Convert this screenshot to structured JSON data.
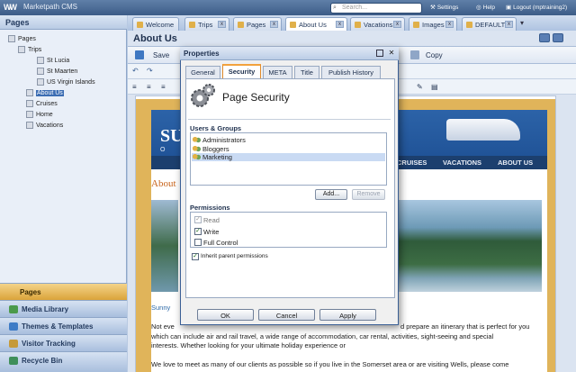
{
  "app": {
    "name": "Marketpath CMS",
    "logo": "WW"
  },
  "topbar": {
    "search_placeholder": "Search...",
    "settings": "Settings",
    "help": "Help",
    "logout": "Logout (mptraining2)"
  },
  "left_panel": {
    "title": "Pages",
    "tree": [
      {
        "label": "Pages",
        "indent": 0
      },
      {
        "label": "Trips",
        "indent": 1
      },
      {
        "label": "St Lucia",
        "indent": 2
      },
      {
        "label": "St Maarten",
        "indent": 2
      },
      {
        "label": "US Virgin Islands",
        "indent": 2
      },
      {
        "label": "About Us",
        "indent": 1,
        "selected": true
      },
      {
        "label": "Cruises",
        "indent": 1
      },
      {
        "label": "Home",
        "indent": 1
      },
      {
        "label": "Vacations",
        "indent": 1
      }
    ],
    "accordion": [
      "Pages",
      "Media Library",
      "Themes & Templates",
      "Visitor Tracking",
      "Recycle Bin"
    ]
  },
  "tabs": [
    {
      "label": "Welcome"
    },
    {
      "label": "Trips"
    },
    {
      "label": "Pages"
    },
    {
      "label": "About Us",
      "active": true
    },
    {
      "label": "Vacations"
    },
    {
      "label": "Images"
    },
    {
      "label": "DEFAULT"
    }
  ],
  "main": {
    "title": "About Us",
    "save_label": "Save",
    "copy_label": "Copy"
  },
  "site": {
    "nav": [
      "CRUISES",
      "VACATIONS",
      "ABOUT US"
    ],
    "heading_fragment": "About",
    "header_fragment": "SU",
    "header_fragment2": "O",
    "caption_fragment": "Sunny",
    "body_lines": [
      "Not eve",
      "which can include air and rail travel, a wide range of accommodation, car rental, activities, sight-seeing and special",
      "interests. Whether looking for your ultimate holiday experience or",
      "We love to meet as many of our clients as possible so if you live in the Somerset area or are visiting Wells, please come"
    ],
    "body_right_fragment": "d prepare an itinerary that is perfect for you"
  },
  "dialog": {
    "title": "Properties",
    "tabs": [
      "General",
      "Security",
      "META",
      "Title",
      "Publish History"
    ],
    "active_tab": "Security",
    "heading": "Page Security",
    "users_label": "Users & Groups",
    "users": [
      {
        "name": "Administrators"
      },
      {
        "name": "Bloggers"
      },
      {
        "name": "Marketing",
        "selected": true
      }
    ],
    "add_label": "Add...",
    "remove_label": "Remove",
    "permissions_label": "Permissions",
    "permissions": [
      {
        "name": "Read",
        "checked": true,
        "disabled": true
      },
      {
        "name": "Write",
        "checked": true
      },
      {
        "name": "Full Control",
        "checked": false
      }
    ],
    "inherit_label": "Inherit parent permissions",
    "inherit_checked": true,
    "ok_label": "OK",
    "cancel_label": "Cancel",
    "apply_label": "Apply"
  }
}
